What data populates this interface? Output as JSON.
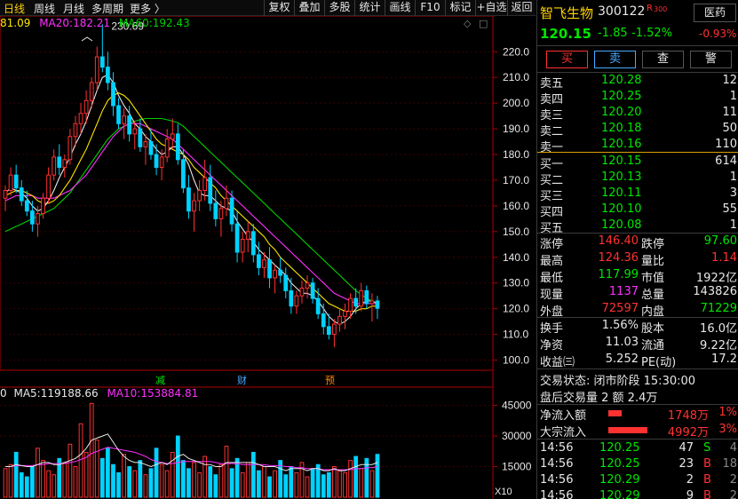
{
  "toolbar": {
    "periods": [
      "日线",
      "周线",
      "月线",
      "多周期",
      "更多 〉"
    ],
    "buttons": [
      "复权",
      "叠加",
      "多股",
      "统计",
      "画线",
      "F10",
      "标记",
      "+自选",
      "返回"
    ]
  },
  "ma_legend": {
    "ma10": "81.09",
    "ma20_label": "MA20:",
    "ma20": "182.21",
    "ma60_label": "MA60:",
    "ma60": "192.43"
  },
  "volume_legend": {
    "lead": "0",
    "ma5_label": "MA5:",
    "ma5": "119188.66",
    "ma10_label": "MA10:",
    "ma10": "153884.81"
  },
  "toggle_icons": [
    "diamond-icon",
    "square-icon"
  ],
  "event_markers": [
    "减",
    "财",
    "预"
  ],
  "volume_multiplier": "X10",
  "colors": {
    "up": "#ff3232",
    "down": "#00d2ff",
    "green": "#00e600",
    "accent": "#ffd200",
    "ma5": "#e8e8e8",
    "ma10": "#ffe600",
    "ma20": "#ff30ff",
    "ma60": "#00d000"
  },
  "chart_data": {
    "type": "candlestick",
    "y_ticks": [
      "220.0",
      "210.0",
      "200.0",
      "190.0",
      "180.0",
      "170.0",
      "160.0",
      "150.0",
      "140.0",
      "130.0",
      "120.0",
      "110.0",
      "100.0"
    ],
    "ylim": [
      95,
      227
    ],
    "high_annotation": "230.69",
    "candles": [
      [
        163,
        168,
        158,
        166
      ],
      [
        166,
        175,
        164,
        172
      ],
      [
        172,
        176,
        165,
        167
      ],
      [
        167,
        170,
        160,
        162
      ],
      [
        162,
        166,
        156,
        158
      ],
      [
        158,
        162,
        150,
        153
      ],
      [
        153,
        160,
        148,
        157
      ],
      [
        157,
        165,
        155,
        163
      ],
      [
        163,
        175,
        161,
        172
      ],
      [
        172,
        182,
        170,
        179
      ],
      [
        179,
        184,
        172,
        175
      ],
      [
        175,
        180,
        171,
        178
      ],
      [
        178,
        190,
        176,
        187
      ],
      [
        187,
        195,
        183,
        192
      ],
      [
        192,
        200,
        188,
        196
      ],
      [
        196,
        205,
        192,
        201
      ],
      [
        201,
        210,
        198,
        208
      ],
      [
        208,
        222,
        205,
        218
      ],
      [
        218,
        230.69,
        212,
        214
      ],
      [
        214,
        220,
        205,
        208
      ],
      [
        208,
        212,
        195,
        199
      ],
      [
        199,
        202,
        190,
        192
      ],
      [
        192,
        198,
        186,
        195
      ],
      [
        195,
        199,
        185,
        188
      ],
      [
        188,
        193,
        182,
        190
      ],
      [
        190,
        194,
        181,
        183
      ],
      [
        183,
        188,
        176,
        185
      ],
      [
        185,
        190,
        178,
        180
      ],
      [
        180,
        184,
        172,
        175
      ],
      [
        175,
        182,
        170,
        179
      ],
      [
        179,
        190,
        177,
        186
      ],
      [
        186,
        194,
        182,
        188
      ],
      [
        188,
        192,
        176,
        178
      ],
      [
        178,
        182,
        165,
        167
      ],
      [
        167,
        172,
        155,
        158
      ],
      [
        158,
        165,
        150,
        162
      ],
      [
        162,
        170,
        158,
        166
      ],
      [
        166,
        178,
        162,
        171
      ],
      [
        171,
        176,
        158,
        161
      ],
      [
        161,
        166,
        152,
        155
      ],
      [
        155,
        162,
        148,
        159
      ],
      [
        159,
        168,
        156,
        163
      ],
      [
        163,
        166,
        150,
        153
      ],
      [
        153,
        158,
        138,
        142
      ],
      [
        142,
        150,
        138,
        147
      ],
      [
        147,
        154,
        142,
        150
      ],
      [
        150,
        153,
        138,
        141
      ],
      [
        141,
        146,
        133,
        136
      ],
      [
        136,
        142,
        132,
        139
      ],
      [
        139,
        144,
        128,
        132
      ],
      [
        132,
        137,
        126,
        135
      ],
      [
        135,
        140,
        130,
        133
      ],
      [
        133,
        136,
        124,
        127
      ],
      [
        127,
        132,
        118,
        121
      ],
      [
        121,
        127,
        118,
        125
      ],
      [
        125,
        131,
        122,
        128
      ],
      [
        128,
        133,
        124,
        130
      ],
      [
        130,
        132,
        122,
        124
      ],
      [
        124,
        128,
        116,
        118
      ],
      [
        118,
        122,
        110,
        113
      ],
      [
        113,
        118,
        108,
        110
      ],
      [
        110,
        116,
        105,
        114
      ],
      [
        114,
        120,
        111,
        117
      ],
      [
        117,
        122,
        112,
        119
      ],
      [
        119,
        126,
        116,
        124
      ],
      [
        124,
        128,
        118,
        121
      ],
      [
        121,
        130,
        119,
        127
      ],
      [
        127,
        129,
        120,
        122
      ],
      [
        122,
        126,
        115,
        123
      ],
      [
        123,
        125,
        116,
        120.15
      ]
    ],
    "ma5": [
      165,
      167,
      166,
      165,
      163,
      160,
      158,
      159,
      162,
      166,
      171,
      175,
      179,
      184,
      188,
      193,
      199,
      205,
      210,
      211,
      208,
      203,
      199,
      196,
      192,
      190,
      187,
      185,
      182,
      180,
      181,
      183,
      183,
      180,
      176,
      170,
      165,
      164,
      164,
      162,
      160,
      159,
      158,
      154,
      151,
      148,
      146,
      143,
      141,
      139,
      137,
      135,
      133,
      130,
      128,
      126,
      126,
      125,
      123,
      120,
      117,
      115,
      114,
      115,
      117,
      120,
      122,
      123,
      123,
      122
    ],
    "ma10": [
      164,
      165,
      166,
      166,
      165,
      164,
      162,
      161,
      161,
      162,
      164,
      167,
      170,
      174,
      178,
      182,
      187,
      192,
      197,
      201,
      203,
      204,
      203,
      201,
      198,
      195,
      192,
      189,
      186,
      184,
      183,
      182,
      181,
      180,
      178,
      175,
      173,
      171,
      169,
      167,
      164,
      162,
      160,
      158,
      156,
      154,
      152,
      150,
      148,
      145,
      143,
      140,
      138,
      136,
      134,
      132,
      130,
      128,
      126,
      124,
      122,
      121,
      120,
      119,
      119,
      119,
      120,
      120,
      121,
      121
    ],
    "ma20": [
      162,
      163,
      164,
      164,
      164,
      164,
      163,
      163,
      163,
      163,
      164,
      165,
      166,
      168,
      170,
      172,
      175,
      178,
      181,
      184,
      187,
      189,
      191,
      192,
      192,
      192,
      191,
      190,
      189,
      188,
      187,
      186,
      184,
      182,
      180,
      178,
      176,
      174,
      172,
      170,
      168,
      166,
      164,
      162,
      160,
      158,
      156,
      154,
      152,
      150,
      148,
      146,
      144,
      142,
      140,
      138,
      136,
      134,
      132,
      130,
      128,
      126,
      125,
      124,
      123,
      122,
      122,
      122,
      122,
      122
    ],
    "ma60": [
      150,
      151,
      152,
      153,
      154,
      155,
      156,
      157,
      158,
      159,
      161,
      163,
      165,
      168,
      171,
      174,
      177,
      180,
      183,
      186,
      188,
      190,
      191,
      192,
      193,
      193.5,
      194,
      194,
      194,
      194,
      193.5,
      193,
      192.4,
      191,
      189,
      187,
      185,
      183,
      181,
      179,
      177,
      175,
      173,
      171,
      169,
      167,
      165,
      163,
      161,
      159,
      157,
      155,
      153,
      151,
      149,
      147,
      145,
      143,
      141,
      139,
      137,
      135,
      133,
      131,
      129,
      127,
      125.5,
      124,
      123,
      122
    ],
    "volume_ticks": [
      "45000",
      "30000",
      "15000"
    ],
    "volume_max": 47000,
    "volumes": [
      14000,
      16000,
      22000,
      12000,
      10000,
      15000,
      24000,
      18000,
      13000,
      11000,
      19000,
      17000,
      26000,
      15000,
      36000,
      22000,
      46000,
      28000,
      19000,
      24000,
      16000,
      12000,
      21000,
      15000,
      13000,
      18000,
      11000,
      14000,
      24000,
      16000,
      13000,
      22000,
      30000,
      18000,
      14000,
      17000,
      12000,
      20000,
      15000,
      11000,
      16000,
      25000,
      14000,
      19000,
      12000,
      17000,
      22000,
      13000,
      15000,
      10000,
      13000,
      18000,
      11000,
      15000,
      12000,
      17000,
      10000,
      14000,
      16000,
      11000,
      12000,
      15000,
      13000,
      12000,
      18000,
      20000,
      14000,
      19000,
      13000,
      21000
    ],
    "volume_ma5": [
      15000,
      15000,
      16000,
      15500,
      15000,
      15000,
      16000,
      17000,
      17000,
      16000,
      16000,
      17000,
      18000,
      19000,
      21000,
      24000,
      28000,
      29000,
      30000,
      31000,
      27000,
      23000,
      20000,
      18000,
      17000,
      17000,
      16000,
      15000,
      16000,
      17000,
      16000,
      18000,
      20000,
      21000,
      19000,
      18000,
      17000,
      16000,
      16000,
      15000,
      15000,
      17000,
      17000,
      17000,
      17000,
      17000,
      17000,
      16000,
      15000,
      15000,
      15000,
      14000,
      13000,
      14000,
      14000,
      14000,
      13000,
      14000,
      14000,
      13000,
      13000,
      14000,
      13000,
      13000,
      14000,
      15000,
      16000,
      16000,
      16000,
      17000
    ],
    "volume_ma10": [
      15000,
      15000,
      15500,
      15500,
      15500,
      15500,
      16000,
      16000,
      16500,
      16500,
      16500,
      16500,
      17000,
      17500,
      18500,
      19500,
      21500,
      22500,
      23500,
      24500,
      24000,
      23500,
      23000,
      22500,
      22000,
      21000,
      20000,
      18500,
      17500,
      17000,
      16500,
      16500,
      17000,
      17500,
      17500,
      17500,
      17500,
      17500,
      17500,
      17000,
      16500,
      16500,
      16500,
      16500,
      16000,
      16000,
      16000,
      16000,
      16000,
      15500,
      15500,
      15500,
      15000,
      15000,
      14500,
      14500,
      14000,
      14000,
      14000,
      13500,
      13500,
      13500,
      13500,
      13500,
      13500,
      14000,
      14000,
      14500,
      14500,
      15000
    ]
  },
  "stock": {
    "name": "智飞生物",
    "code": "300122",
    "tag": "R",
    "tag_num": "300",
    "sector": "医药",
    "sector_change": "-0.93%",
    "price": "120.15",
    "change": "-1.85",
    "change_pct": "-1.52%"
  },
  "trade_buttons": [
    {
      "label": "买",
      "color": "#ff3232",
      "border": "#ff3232"
    },
    {
      "label": "卖",
      "color": "#4aa8ff",
      "border": "#4aa8ff"
    },
    {
      "label": "查",
      "color": "#e8e8e8",
      "border": "#555555"
    },
    {
      "label": "警",
      "color": "#e8e8e8",
      "border": "#555555"
    }
  ],
  "order_book": {
    "asks": [
      {
        "label": "卖五",
        "price": "120.28",
        "vol": "12"
      },
      {
        "label": "卖四",
        "price": "120.25",
        "vol": "1"
      },
      {
        "label": "卖三",
        "price": "120.20",
        "vol": "11"
      },
      {
        "label": "卖二",
        "price": "120.18",
        "vol": "50"
      },
      {
        "label": "卖一",
        "price": "120.16",
        "vol": "110"
      }
    ],
    "bids": [
      {
        "label": "买一",
        "price": "120.15",
        "vol": "614"
      },
      {
        "label": "买二",
        "price": "120.13",
        "vol": "1"
      },
      {
        "label": "买三",
        "price": "120.11",
        "vol": "3"
      },
      {
        "label": "买四",
        "price": "120.10",
        "vol": "55"
      },
      {
        "label": "买五",
        "price": "120.08",
        "vol": "1"
      }
    ]
  },
  "stats": [
    {
      "l1": "涨停",
      "v1": "146.40",
      "c1": "#ff3232",
      "l2": "跌停",
      "v2": "97.60",
      "c2": "#00e600"
    },
    {
      "l1": "最高",
      "v1": "124.36",
      "c1": "#ff3232",
      "l2": "量比",
      "v2": "1.14",
      "c2": "#ff3232"
    },
    {
      "l1": "最低",
      "v1": "117.99",
      "c1": "#00e600",
      "l2": "市值",
      "v2": "1922亿",
      "c2": "#e8e8e8"
    },
    {
      "l1": "现量",
      "v1": "1137",
      "c1": "#ff30ff",
      "l2": "总量",
      "v2": "143826",
      "c2": "#e8e8e8"
    },
    {
      "l1": "外盘",
      "v1": "72597",
      "c1": "#ff3232",
      "l2": "内盘",
      "v2": "71229",
      "c2": "#00e600"
    }
  ],
  "fundamentals": [
    {
      "l1": "换手",
      "v1": "1.56%",
      "l2": "股本",
      "v2": "16.0亿"
    },
    {
      "l1": "净资",
      "v1": "11.03",
      "l2": "流通",
      "v2": "9.22亿"
    },
    {
      "l1": "收益㈢",
      "v1": "5.252",
      "l2": "PE(动)",
      "v2": "17.2"
    }
  ],
  "trade_status": "交易状态: 闭市阶段 15:30:00",
  "after_hours": "盘后交易量 2 额 2.4万",
  "flows": [
    {
      "label": "净流入额",
      "value": "1748万",
      "pct": "1%",
      "fill": 0.35
    },
    {
      "label": "大宗流入",
      "value": "4992万",
      "pct": "3%",
      "fill": 1.0
    }
  ],
  "ticks": [
    {
      "time": "14:56",
      "price": "120.25",
      "vol": "47",
      "side": "S",
      "extra": "4",
      "side_color": "#00e600"
    },
    {
      "time": "14:56",
      "price": "120.25",
      "vol": "23",
      "side": "B",
      "extra": "18",
      "side_color": "#ff3232"
    },
    {
      "time": "14:56",
      "price": "120.29",
      "vol": "2",
      "side": "B",
      "extra": "2",
      "side_color": "#ff3232"
    },
    {
      "time": "14:56",
      "price": "120.29",
      "vol": "9",
      "side": "B",
      "extra": "2",
      "side_color": "#ff3232"
    }
  ]
}
